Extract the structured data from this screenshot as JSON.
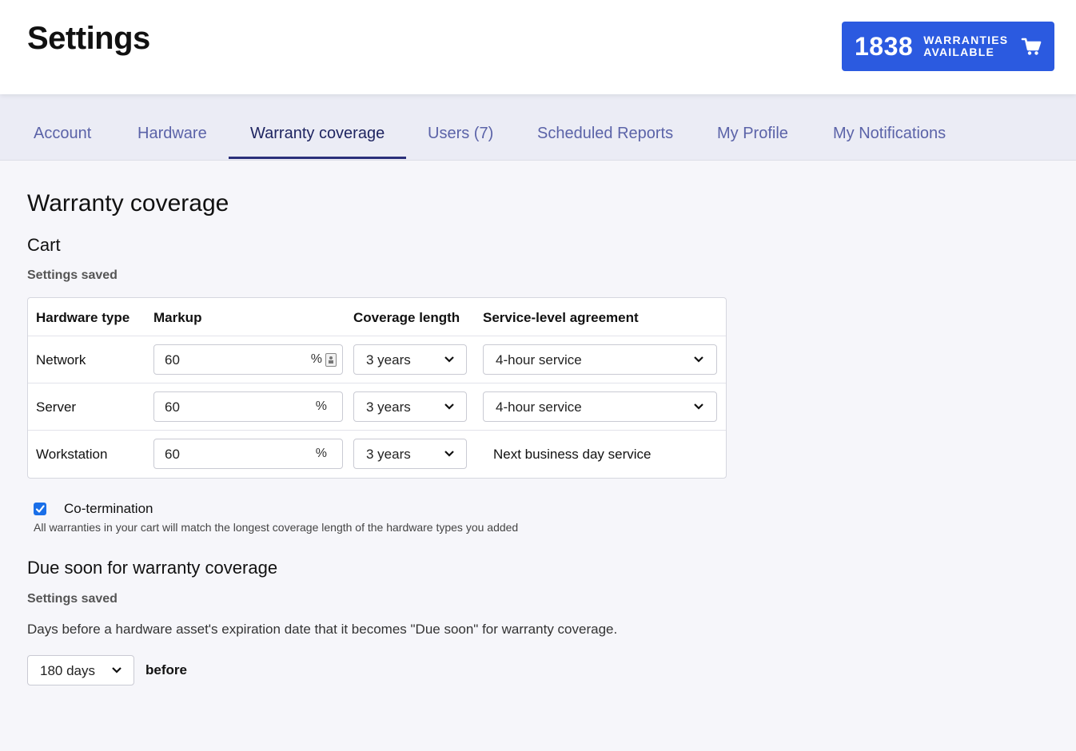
{
  "header": {
    "title": "Settings",
    "warranty_count": "1838",
    "warranty_label_line1": "WARRANTIES",
    "warranty_label_line2": "AVAILABLE"
  },
  "tabs": [
    {
      "label": "Account"
    },
    {
      "label": "Hardware"
    },
    {
      "label": "Warranty coverage",
      "active": true
    },
    {
      "label": "Users (7)"
    },
    {
      "label": "Scheduled Reports"
    },
    {
      "label": "My Profile"
    },
    {
      "label": "My Notifications"
    }
  ],
  "main": {
    "title": "Warranty coverage",
    "cart": {
      "title": "Cart",
      "status": "Settings saved",
      "columns": [
        "Hardware type",
        "Markup",
        "Coverage length",
        "Service-level agreement"
      ],
      "rows": [
        {
          "type": "Network",
          "markup": "60",
          "markup_unit": "%",
          "coverage": "3 years",
          "sla": "4-hour service"
        },
        {
          "type": "Server",
          "markup": "60",
          "markup_unit": "%",
          "coverage": "3 years",
          "sla": "4-hour service"
        },
        {
          "type": "Workstation",
          "markup": "60",
          "markup_unit": "%",
          "coverage": "3 years",
          "sla": "Next business day service"
        }
      ],
      "cotermination_label": "Co-termination",
      "cotermination_checked": true,
      "cotermination_help": "All warranties in your cart will match the longest coverage length of the hardware types you added"
    },
    "due_soon": {
      "title": "Due soon for warranty coverage",
      "status": "Settings saved",
      "description": "Days before a hardware asset's expiration date that it becomes \"Due soon\" for warranty coverage.",
      "days_value": "180 days",
      "suffix": "before"
    }
  },
  "colors": {
    "accent": "#2b5ae0",
    "tab_active": "#1f2561",
    "tab_inactive": "#5b63a8",
    "checkbox": "#1a6fe8"
  }
}
